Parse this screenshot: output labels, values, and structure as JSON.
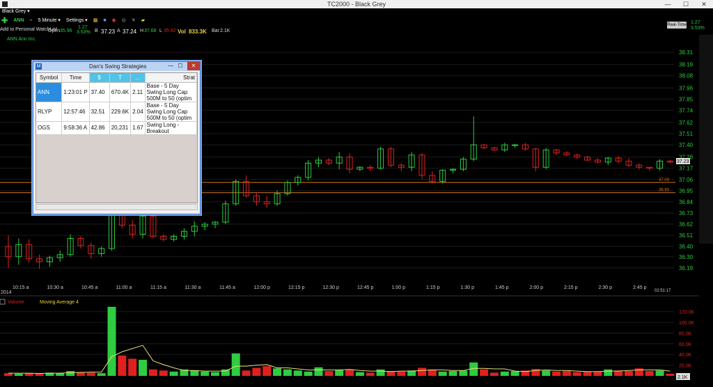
{
  "window": {
    "title": "TC2000 - Black Grey",
    "minimize": "—",
    "maximize": "☐",
    "close": "✕"
  },
  "menu": {
    "layout_name": "Black Grey ▾"
  },
  "toolbar": {
    "symbol": "ANN",
    "interval": "5 Minute ▾",
    "settings": "Settings ▾",
    "add_watchlist": "Add to Personal WatchList"
  },
  "quote": {
    "open_label": "Open",
    "open": "35.96",
    "change": "1.27",
    "change_pct": "3.53%",
    "bid_label": "B",
    "bid": "37.23",
    "ask_label": "A",
    "ask": "37.24",
    "high_label": "H",
    "high": "37.68",
    "low_label": "L",
    "low": "35.42",
    "vol_label": "Vol",
    "vol": "833.3K",
    "bar_label": "Bar",
    "bar": "2.1K"
  },
  "realtime": {
    "label": "Real-Time",
    "change": "1.27",
    "change_pct": "3.53%"
  },
  "chart": {
    "company": "ANN Ann Inc.",
    "last_price": "37.23",
    "line_labels": [
      "37.03",
      "36.93"
    ],
    "y_ticks": [
      "38.31",
      "38.19",
      "38.08",
      "37.96",
      "37.85",
      "37.74",
      "37.62",
      "37.51",
      "37.40",
      "37.28",
      "37.17",
      "37.06",
      "36.95",
      "36.84",
      "36.73",
      "36.62",
      "36.51",
      "36.40",
      "36.30",
      "36.19"
    ],
    "x_ticks": [
      "10:15 a",
      "10:30 a",
      "10:45 a",
      "11:00 a",
      "11:15 a",
      "11:30 a",
      "11:45 a",
      "12:00 p",
      "12:15 p",
      "12:30 p",
      "12:45 p",
      "1:00 p",
      "1:15 p",
      "1:30 p",
      "1:45 p",
      "2:00 p",
      "2:15 p",
      "2:30 p",
      "2:45 p"
    ],
    "year": "2014",
    "clock": "02:51:17",
    "volume_label": "Volume",
    "ma_label": "Moving Average 4",
    "vol_ticks": [
      "120.0K",
      "100.0K",
      "80.0K",
      "60.0K",
      "40.0K",
      "20.0K"
    ],
    "last_vol": "2.1K",
    "colors": {
      "up": "#2ecc40",
      "down": "#e02020",
      "ma": "#e8e07a",
      "hline": "#d77a1e"
    }
  },
  "chart_data": {
    "type": "candlestick",
    "title": "ANN Ann Inc.",
    "interval": "5 Minute",
    "ylim": [
      36.1,
      38.4
    ],
    "candles": [
      [
        36.4,
        36.51,
        36.19,
        36.3
      ],
      [
        36.3,
        36.48,
        36.22,
        36.42
      ],
      [
        36.42,
        36.47,
        36.24,
        36.28
      ],
      [
        36.28,
        36.32,
        36.18,
        36.25
      ],
      [
        36.25,
        36.31,
        36.2,
        36.29
      ],
      [
        36.29,
        36.36,
        36.25,
        36.32
      ],
      [
        36.32,
        36.52,
        36.3,
        36.48
      ],
      [
        36.48,
        36.5,
        36.38,
        36.41
      ],
      [
        36.41,
        36.44,
        36.28,
        36.33
      ],
      [
        36.33,
        36.4,
        36.3,
        36.38
      ],
      [
        36.38,
        36.78,
        36.36,
        36.72
      ],
      [
        36.72,
        36.82,
        36.58,
        36.61
      ],
      [
        36.61,
        36.66,
        36.48,
        36.52
      ],
      [
        36.52,
        36.74,
        36.48,
        36.7
      ],
      [
        36.7,
        36.72,
        36.48,
        36.5
      ],
      [
        36.5,
        36.52,
        36.45,
        36.47
      ],
      [
        36.47,
        36.52,
        36.45,
        36.5
      ],
      [
        36.5,
        36.58,
        36.47,
        36.55
      ],
      [
        36.55,
        36.65,
        36.5,
        36.6
      ],
      [
        36.6,
        36.64,
        36.56,
        36.62
      ],
      [
        36.62,
        36.65,
        36.58,
        36.64
      ],
      [
        36.64,
        36.85,
        36.62,
        36.82
      ],
      [
        36.82,
        37.06,
        36.8,
        37.04
      ],
      [
        37.04,
        37.1,
        36.88,
        36.9
      ],
      [
        36.9,
        36.93,
        36.8,
        36.84
      ],
      [
        36.84,
        36.9,
        36.78,
        36.82
      ],
      [
        36.82,
        36.95,
        36.8,
        36.92
      ],
      [
        36.92,
        37.05,
        36.9,
        37.03
      ],
      [
        37.03,
        37.1,
        37.0,
        37.08
      ],
      [
        37.08,
        37.25,
        37.05,
        37.22
      ],
      [
        37.22,
        37.28,
        37.18,
        37.25
      ],
      [
        37.25,
        37.27,
        37.2,
        37.22
      ],
      [
        37.22,
        37.33,
        37.16,
        37.28
      ],
      [
        37.28,
        37.32,
        37.12,
        37.16
      ],
      [
        37.16,
        37.19,
        37.14,
        37.18
      ],
      [
        37.18,
        37.2,
        37.14,
        37.17
      ],
      [
        37.17,
        37.38,
        37.16,
        37.36
      ],
      [
        37.36,
        37.38,
        37.18,
        37.2
      ],
      [
        37.2,
        37.22,
        37.14,
        37.18
      ],
      [
        37.18,
        37.33,
        37.14,
        37.3
      ],
      [
        37.3,
        37.32,
        37.06,
        37.1
      ],
      [
        37.1,
        37.14,
        37.02,
        37.04
      ],
      [
        37.04,
        37.16,
        37.02,
        37.15
      ],
      [
        37.15,
        37.17,
        37.12,
        37.16
      ],
      [
        37.16,
        37.28,
        37.14,
        37.26
      ],
      [
        37.26,
        37.68,
        37.24,
        37.4
      ],
      [
        37.4,
        37.41,
        37.36,
        37.37
      ],
      [
        37.37,
        37.38,
        37.34,
        37.35
      ],
      [
        37.35,
        37.42,
        37.33,
        37.4
      ],
      [
        37.4,
        37.41,
        37.37,
        37.4
      ],
      [
        37.4,
        37.42,
        37.34,
        37.36
      ],
      [
        37.36,
        37.37,
        37.14,
        37.18
      ],
      [
        37.18,
        37.37,
        37.16,
        37.35
      ],
      [
        37.35,
        37.36,
        37.3,
        37.32
      ],
      [
        37.32,
        37.34,
        37.29,
        37.3
      ],
      [
        37.3,
        37.31,
        37.26,
        37.28
      ],
      [
        37.28,
        37.29,
        37.24,
        37.25
      ],
      [
        37.25,
        37.27,
        37.22,
        37.23
      ],
      [
        37.23,
        37.28,
        37.2,
        37.27
      ],
      [
        37.27,
        37.29,
        37.22,
        37.24
      ],
      [
        37.24,
        37.27,
        37.18,
        37.2
      ],
      [
        37.2,
        37.22,
        37.16,
        37.18
      ],
      [
        37.18,
        37.18,
        37.15,
        37.17
      ],
      [
        37.17,
        37.26,
        37.15,
        37.24
      ],
      [
        37.24,
        37.25,
        37.22,
        37.23
      ]
    ],
    "volume": [
      5,
      4,
      5,
      4,
      6,
      5,
      9,
      7,
      6,
      5,
      129,
      38,
      32,
      30,
      12,
      10,
      8,
      12,
      10,
      8,
      7,
      12,
      42,
      10,
      15,
      18,
      14,
      12,
      10,
      8,
      16,
      9,
      11,
      12,
      7,
      6,
      12,
      9,
      8,
      10,
      15,
      12,
      8,
      9,
      10,
      25,
      12,
      6,
      8,
      9,
      10,
      13,
      10,
      8,
      9,
      7,
      8,
      8,
      12,
      10,
      9,
      14,
      9,
      10,
      4
    ],
    "ma": [
      5,
      5,
      5,
      4.5,
      5,
      5,
      6,
      6.5,
      7,
      7,
      36,
      45,
      51,
      57,
      28,
      21,
      15,
      10,
      10,
      9,
      9,
      9,
      18,
      18,
      20,
      21,
      15,
      15,
      13,
      11,
      11,
      11,
      11,
      12,
      10,
      9,
      9,
      8,
      9,
      9,
      10,
      11,
      11,
      10,
      10,
      14,
      14,
      13,
      13,
      9,
      8,
      10,
      11,
      10,
      10,
      9,
      8,
      8,
      9,
      9,
      10,
      11,
      11,
      11,
      9
    ],
    "volume_ylim": [
      0,
      130000
    ],
    "reference_lines": [
      37.03,
      36.93
    ]
  },
  "dialog": {
    "title": "Dan's Swing Strategies",
    "icon": "M",
    "columns": [
      "Symbol",
      "Time",
      "$",
      "T",
      "...",
      "Strat"
    ],
    "rows": [
      {
        "symbol": "ANN",
        "time": "1:23:01 P",
        "price": "37.40",
        "vol": "670.4K",
        "ratio": "2.11",
        "strat": "Base - 5 Day Swing Long Cap 500M to 50 (optim"
      },
      {
        "symbol": "RLYP",
        "time": "12:57:46",
        "price": "32.51",
        "vol": "229.6K",
        "ratio": "2.04",
        "strat": "Base - 5 Day Swing Long Cap 500M to 50 (optim"
      },
      {
        "symbol": "OGS",
        "time": "9:58:36 A",
        "price": "42.86",
        "vol": "20,231",
        "ratio": "1.67",
        "strat": "Swing Long - Breakout"
      }
    ]
  }
}
